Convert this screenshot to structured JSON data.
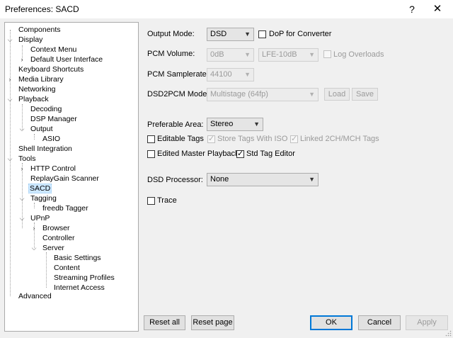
{
  "window": {
    "title": "Preferences: SACD",
    "help_symbol": "?",
    "close_symbol": "✕"
  },
  "tree": {
    "items": [
      {
        "label": "Components"
      },
      {
        "label": "Display"
      },
      {
        "label": "Context Menu"
      },
      {
        "label": "Default User Interface"
      },
      {
        "label": "Keyboard Shortcuts"
      },
      {
        "label": "Media Library"
      },
      {
        "label": "Networking"
      },
      {
        "label": "Playback"
      },
      {
        "label": "Decoding"
      },
      {
        "label": "DSP Manager"
      },
      {
        "label": "Output"
      },
      {
        "label": "ASIO"
      },
      {
        "label": "Shell Integration"
      },
      {
        "label": "Tools"
      },
      {
        "label": "HTTP Control"
      },
      {
        "label": "ReplayGain Scanner"
      },
      {
        "label": "SACD",
        "selected": true
      },
      {
        "label": "Tagging"
      },
      {
        "label": "freedb Tagger"
      },
      {
        "label": "UPnP"
      },
      {
        "label": "Browser"
      },
      {
        "label": "Controller"
      },
      {
        "label": "Server"
      },
      {
        "label": "Basic Settings"
      },
      {
        "label": "Content"
      },
      {
        "label": "Streaming Profiles"
      },
      {
        "label": "Internet Access"
      },
      {
        "label": "Advanced"
      }
    ]
  },
  "settings": {
    "output_mode": {
      "label": "Output Mode:",
      "value": "DSD"
    },
    "dop": {
      "label": "DoP for Converter",
      "checked": false
    },
    "pcm_volume": {
      "label": "PCM Volume:",
      "value": "0dB",
      "lfe_value": "LFE-10dB"
    },
    "log_overloads": {
      "label": "Log Overloads",
      "checked": false
    },
    "pcm_samplerate": {
      "label": "PCM Samplerate:",
      "value": "44100"
    },
    "dsd2pcm_mode": {
      "label": "DSD2PCM Mode:",
      "value": "Multistage (64fp)",
      "load_label": "Load",
      "save_label": "Save"
    },
    "preferable_area": {
      "label": "Preferable Area:",
      "value": "Stereo"
    },
    "editable_tags": {
      "label": "Editable Tags",
      "checked": false
    },
    "store_tags_iso": {
      "label": "Store Tags With ISO",
      "checked": true
    },
    "linked_tags": {
      "label": "Linked 2CH/MCH Tags",
      "checked": true
    },
    "edited_master": {
      "label": "Edited Master Playback",
      "checked": false
    },
    "std_tag_editor": {
      "label": "Std Tag Editor",
      "checked": true
    },
    "dsd_processor": {
      "label": "DSD Processor:",
      "value": "None"
    },
    "trace": {
      "label": "Trace",
      "checked": false
    }
  },
  "buttons": {
    "reset_all": "Reset all",
    "reset_page": "Reset page",
    "ok": "OK",
    "cancel": "Cancel",
    "apply": "Apply"
  },
  "icons": {
    "dropdown": "chevron-down-icon",
    "expand_open": "chevron-down-icon",
    "expand_closed": "chevron-right-icon"
  }
}
